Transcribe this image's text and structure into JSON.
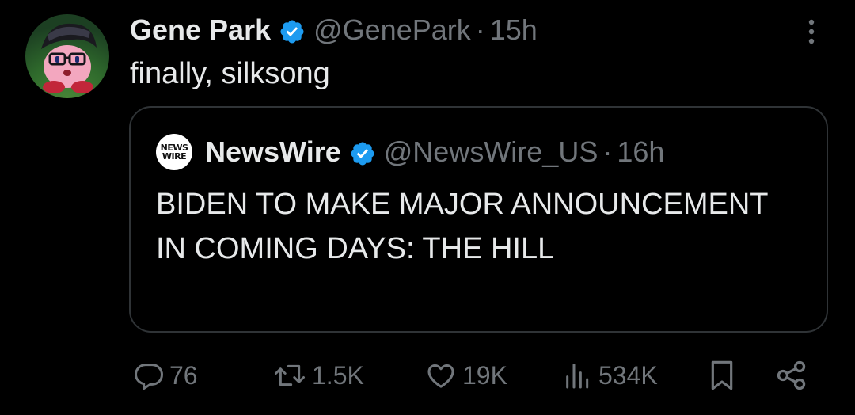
{
  "tweet": {
    "author_name": "Gene Park",
    "handle": "@GenePark",
    "separator": "·",
    "time": "15h",
    "text": "finally, silksong",
    "avatar_icon": "kirby-avatar-icon",
    "verified_color": "#1d9bf0"
  },
  "quote": {
    "logo_line1": "NEWS",
    "logo_line2": "WIRE",
    "author_name": "NewsWire",
    "handle": "@NewsWire_US",
    "separator": "·",
    "time": "16h",
    "text": "BIDEN TO MAKE MAJOR ANNOUNCEMENT IN COMING DAYS: THE HILL"
  },
  "actions": {
    "replies": "76",
    "reposts": "1.5K",
    "likes": "19K",
    "views": "534K"
  },
  "colors": {
    "background": "#000000",
    "text": "#e7e9ea",
    "muted": "#71767b",
    "border": "#2f3336",
    "accent": "#1d9bf0"
  }
}
